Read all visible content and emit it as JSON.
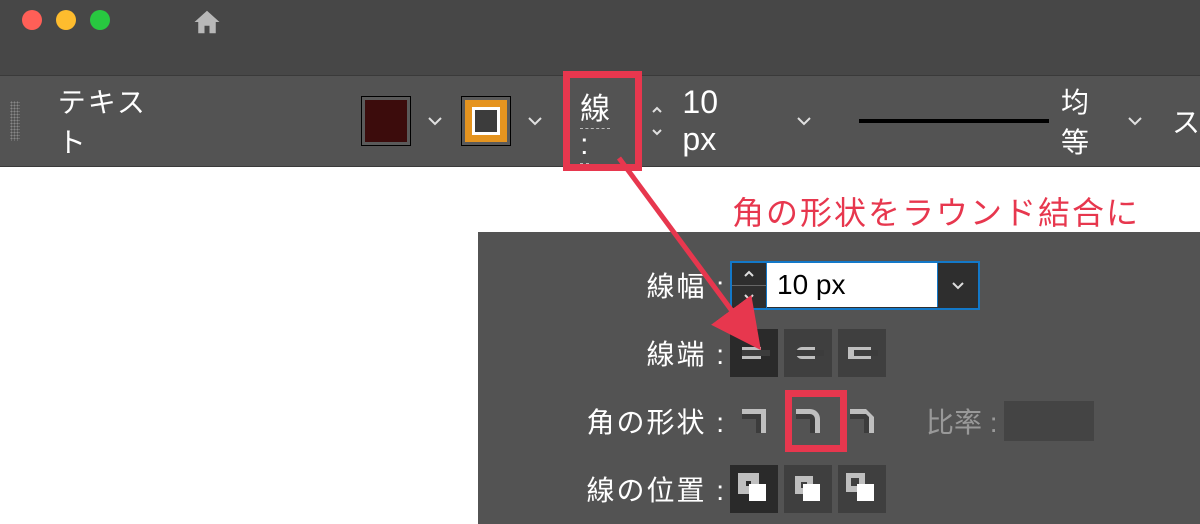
{
  "toolbar": {
    "tool_label": "テキスト",
    "fill_color": "#3c0c0c",
    "stroke_color": "#e5941f",
    "stroke_label": "線 :",
    "stroke_width": "10 px",
    "dash_label": "均等"
  },
  "panel": {
    "width_label": "線幅 :",
    "width_value": "10 px",
    "cap_label": "線端 :",
    "caps": [
      "butt",
      "round",
      "projecting"
    ],
    "cap_selected": 0,
    "corner_label": "角の形状 :",
    "corners": [
      "miter",
      "round",
      "bevel"
    ],
    "corner_selected": 1,
    "ratio_label": "比率 :",
    "align_label": "線の位置 :",
    "aligns": [
      "center",
      "inside",
      "outside"
    ],
    "align_selected": 0
  },
  "annotation": "角の形状をラウンド結合に"
}
